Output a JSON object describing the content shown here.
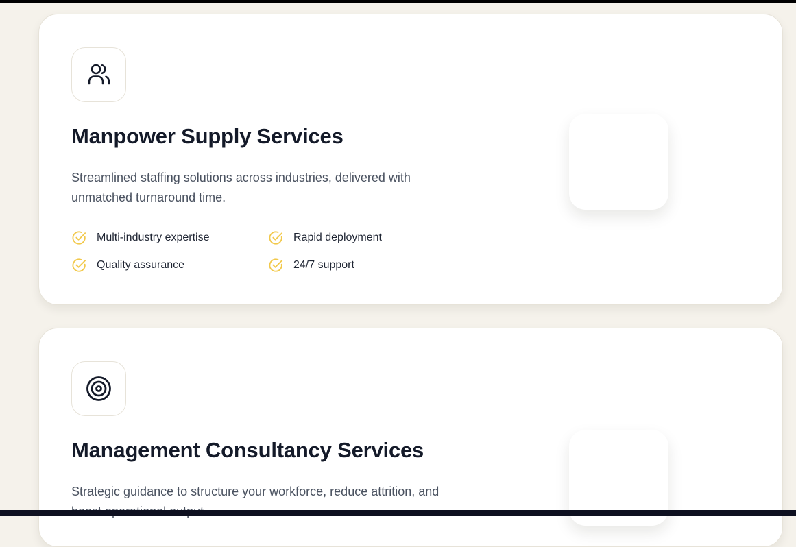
{
  "services": [
    {
      "icon": "users-icon",
      "title": "Manpower Supply Services",
      "description": "Streamlined staffing solutions across industries, delivered with unmatched turnaround time.",
      "features": [
        "Multi-industry expertise",
        "Rapid deployment",
        "Quality assurance",
        "24/7 support"
      ]
    },
    {
      "icon": "target-icon",
      "title": "Management Consultancy Services",
      "description": "Strategic guidance to structure your workforce, reduce attrition, and boost operational output."
    }
  ],
  "colors": {
    "background": "#f5f2eb",
    "card": "#ffffff",
    "accent": "#f2c94c",
    "heading": "#141a29",
    "body_text": "#4a5260"
  }
}
